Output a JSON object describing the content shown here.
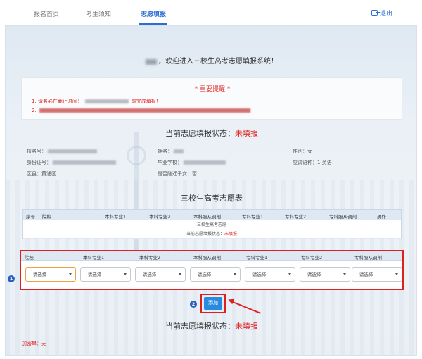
{
  "nav": {
    "items": [
      "报名首页",
      "考生须知",
      "志愿填报"
    ],
    "logout": "退出"
  },
  "welcome": "，欢迎进入三校生高考志愿填报系统！",
  "notice": {
    "title": "* 重要提醒 *",
    "line1_prefix": "1. 请务必在截止时间：",
    "line1_suffix": "前完成填报！",
    "line2_prefix": "2."
  },
  "status": {
    "label": "当前志愿填报状态：",
    "value": "未填报"
  },
  "info": {
    "reg_no": "报名号：",
    "name": "姓名：",
    "gender": "性别：女",
    "id_no": "身份证号：",
    "school": "毕业学校：",
    "exam_lang": "应试语种：1.英语",
    "district": "区县：黄浦区",
    "veteran_child": "是否随迁子女：否"
  },
  "table_title": "三校生高考志愿表",
  "table1": {
    "headers": [
      "序号",
      "院校",
      "本科专业1",
      "本科专业2",
      "本科服从调剂",
      "专科专业1",
      "专科专业2",
      "专科服从调剂",
      "操作"
    ],
    "row1": "三校生高考志愿",
    "row2_label": "当前志愿填报状态：",
    "row2_value": "未填报"
  },
  "table2": {
    "headers": [
      "院校",
      "本科专业1",
      "本科专业2",
      "本科服从调剂",
      "专科专业1",
      "专科专业2",
      "专科服从调剂"
    ],
    "placeholder": "--请选择--"
  },
  "markers": {
    "one": "1",
    "two": "2"
  },
  "add_button": "添加",
  "footer": "加密串：无",
  "colors": {
    "accent": "#2a6fd0",
    "alert": "#e02020",
    "button": "#2a8ae0"
  }
}
